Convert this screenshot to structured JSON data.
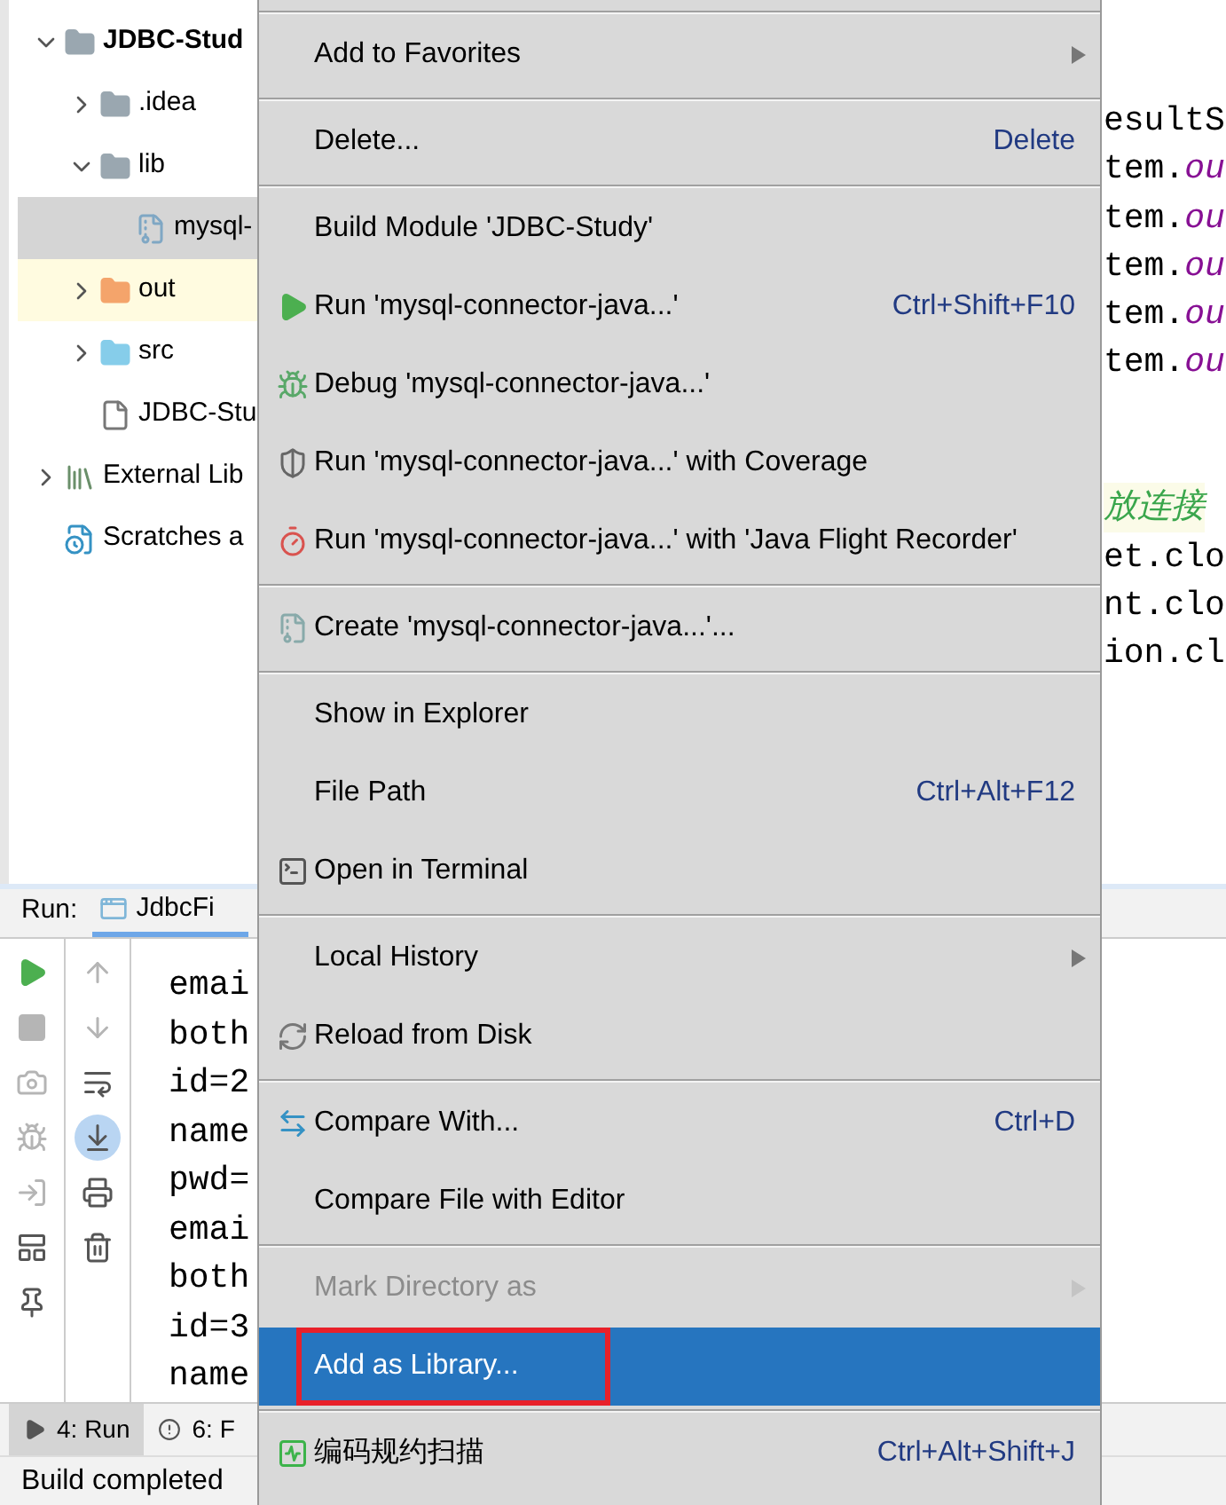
{
  "project_tree": {
    "items": [
      {
        "label": "JDBC-Stud",
        "kind": "module",
        "expanded": true,
        "selected": false,
        "excluded": false,
        "children": [
          {
            "label": ".idea",
            "kind": "folder",
            "expanded": false,
            "selected": false,
            "excluded": false
          },
          {
            "label": "lib",
            "kind": "folder",
            "expanded": true,
            "selected": false,
            "excluded": false,
            "children": [
              {
                "label": "mysql-",
                "kind": "jar",
                "selected": true,
                "excluded": false
              }
            ]
          },
          {
            "label": "out",
            "kind": "folder",
            "expanded": false,
            "selected": false,
            "excluded": true
          },
          {
            "label": "src",
            "kind": "source",
            "expanded": false,
            "selected": false,
            "excluded": false
          },
          {
            "label": "JDBC-Stu",
            "kind": "file",
            "selected": false,
            "excluded": false
          }
        ]
      },
      {
        "label": "External Lib",
        "kind": "libraries",
        "expanded": false,
        "selected": false,
        "excluded": false
      },
      {
        "label": "Scratches a",
        "kind": "scratches",
        "selected": false,
        "excluded": false
      }
    ]
  },
  "editor": {
    "blocks": [
      [
        [
          {
            "text": "esultS",
            "kind": "plain"
          }
        ],
        [
          {
            "text": "tem.",
            "kind": "plain"
          },
          {
            "text": "ou",
            "kind": "field"
          }
        ],
        [
          {
            "text": "tem.",
            "kind": "plain"
          },
          {
            "text": "ou",
            "kind": "field"
          }
        ],
        [
          {
            "text": "tem.",
            "kind": "plain"
          },
          {
            "text": "ou",
            "kind": "field"
          }
        ],
        [
          {
            "text": "tem.",
            "kind": "plain"
          },
          {
            "text": "ou",
            "kind": "field"
          }
        ],
        [
          {
            "text": "tem.",
            "kind": "plain"
          },
          {
            "text": "ou",
            "kind": "field"
          }
        ]
      ],
      [
        [
          {
            "text": "放连接",
            "kind": "comment"
          }
        ],
        [
          {
            "text": "et.clo",
            "kind": "plain"
          }
        ],
        [
          {
            "text": "nt.clo",
            "kind": "plain"
          }
        ],
        [
          {
            "text": "ion.cl",
            "kind": "plain"
          }
        ]
      ]
    ]
  },
  "run_panel": {
    "title": "Run:",
    "tab": "JdbcFi",
    "autoscroll": {
      "on": true
    },
    "console": [
      "emai",
      "both",
      "id=2",
      "name",
      "pwd=",
      "emai",
      "both",
      "id=3",
      "name"
    ]
  },
  "tool_tabs": [
    {
      "label": "4: Run",
      "selected": true
    },
    {
      "label": "6: F",
      "selected": false
    }
  ],
  "status_bar": "Build completed",
  "context_menu": {
    "items": [
      {
        "kind": "separator"
      },
      {
        "kind": "item",
        "label": "Add to Favorites",
        "submenu": true,
        "disabled": false,
        "selected": false,
        "annotated": false
      },
      {
        "kind": "separator"
      },
      {
        "kind": "item",
        "label": "Delete...",
        "shortcut": "Delete",
        "submenu": false,
        "disabled": false,
        "selected": false,
        "annotated": false
      },
      {
        "kind": "separator"
      },
      {
        "kind": "item",
        "label": "Build Module 'JDBC-Study'",
        "submenu": false,
        "disabled": false,
        "selected": false,
        "annotated": false
      },
      {
        "kind": "item",
        "label": "Run 'mysql-connector-java...'",
        "shortcut": "Ctrl+Shift+F10",
        "submenu": false,
        "disabled": false,
        "selected": false,
        "annotated": false
      },
      {
        "kind": "item",
        "label": "Debug 'mysql-connector-java...'",
        "submenu": false,
        "disabled": false,
        "selected": false,
        "annotated": false
      },
      {
        "kind": "item",
        "label": "Run 'mysql-connector-java...' with Coverage",
        "submenu": false,
        "disabled": false,
        "selected": false,
        "annotated": false
      },
      {
        "kind": "item",
        "label": "Run 'mysql-connector-java...' with 'Java Flight Recorder'",
        "submenu": false,
        "disabled": false,
        "selected": false,
        "annotated": false
      },
      {
        "kind": "separator"
      },
      {
        "kind": "item",
        "label": "Create 'mysql-connector-java...'...",
        "submenu": false,
        "disabled": false,
        "selected": false,
        "annotated": false
      },
      {
        "kind": "separator"
      },
      {
        "kind": "item",
        "label": "Show in Explorer",
        "submenu": false,
        "disabled": false,
        "selected": false,
        "annotated": false
      },
      {
        "kind": "item",
        "label": "File Path",
        "shortcut": "Ctrl+Alt+F12",
        "submenu": false,
        "disabled": false,
        "selected": false,
        "annotated": false
      },
      {
        "kind": "item",
        "label": "Open in Terminal",
        "submenu": false,
        "disabled": false,
        "selected": false,
        "annotated": false
      },
      {
        "kind": "separator"
      },
      {
        "kind": "item",
        "label": "Local History",
        "submenu": true,
        "disabled": false,
        "selected": false,
        "annotated": false
      },
      {
        "kind": "item",
        "label": "Reload from Disk",
        "submenu": false,
        "disabled": false,
        "selected": false,
        "annotated": false
      },
      {
        "kind": "separator"
      },
      {
        "kind": "item",
        "label": "Compare With...",
        "shortcut": "Ctrl+D",
        "submenu": false,
        "disabled": false,
        "selected": false,
        "annotated": false
      },
      {
        "kind": "item",
        "label": "Compare File with Editor",
        "submenu": false,
        "disabled": false,
        "selected": false,
        "annotated": false
      },
      {
        "kind": "separator"
      },
      {
        "kind": "item",
        "label": "Mark Directory as",
        "submenu": true,
        "disabled": true,
        "selected": false,
        "annotated": false
      },
      {
        "kind": "item",
        "label": "Add as Library...",
        "submenu": false,
        "disabled": false,
        "selected": true,
        "annotated": true
      },
      {
        "kind": "separator"
      },
      {
        "kind": "item",
        "label": "编码规约扫描",
        "shortcut": "Ctrl+Alt+Shift+J",
        "submenu": false,
        "disabled": false,
        "selected": false,
        "annotated": false
      }
    ]
  }
}
